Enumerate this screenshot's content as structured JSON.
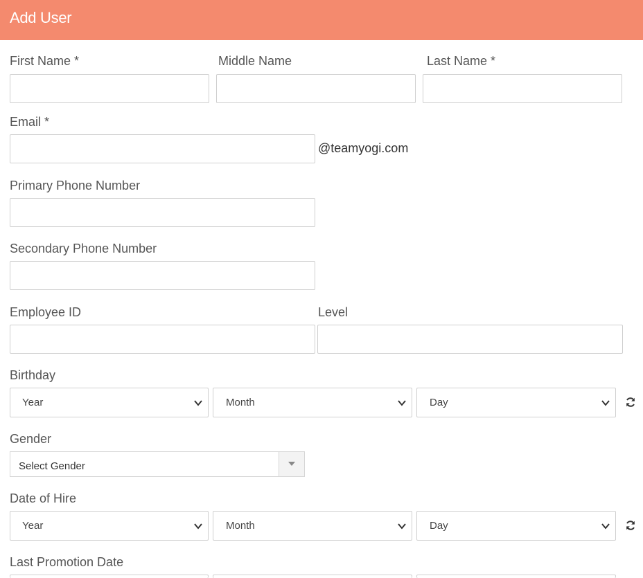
{
  "header": {
    "title": "Add User"
  },
  "form": {
    "first_name_label": "First Name *",
    "middle_name_label": "Middle Name",
    "last_name_label": "Last Name *",
    "email_label": "Email *",
    "email_domain": "@teamyogi.com",
    "primary_phone_label": "Primary Phone Number",
    "secondary_phone_label": "Secondary Phone Number",
    "employee_id_label": "Employee ID",
    "level_label": "Level",
    "birthday": {
      "label": "Birthday",
      "year": "Year",
      "month": "Month",
      "day": "Day"
    },
    "gender": {
      "label": "Gender",
      "selected": "Select Gender"
    },
    "date_of_hire": {
      "label": "Date of Hire",
      "year": "Year",
      "month": "Month",
      "day": "Day"
    },
    "last_promotion": {
      "label": "Last Promotion Date"
    }
  },
  "icons": {
    "refresh": "refresh-icon",
    "chevron": "chevron-down-icon"
  },
  "colors": {
    "header_bg": "#f48a6e",
    "border": "#cfcfcf"
  }
}
